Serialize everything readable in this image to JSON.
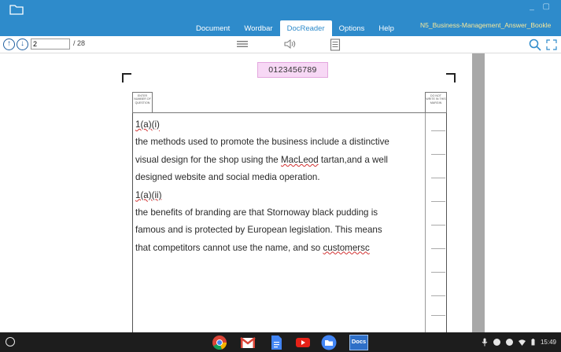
{
  "window": {
    "document_title": "N5_Business-Management_Answer_Bookle",
    "controls_glyph": "_ ▢"
  },
  "menu": {
    "items": [
      {
        "label": "Document",
        "active": false
      },
      {
        "label": "Wordbar",
        "active": false
      },
      {
        "label": "DocReader",
        "active": true
      },
      {
        "label": "Options",
        "active": false
      },
      {
        "label": "Help",
        "active": false
      }
    ]
  },
  "toolbar": {
    "page_input_value": "2",
    "page_count": "/ 28",
    "up_glyph": "↑",
    "down_glyph": "↓"
  },
  "sheet": {
    "candidate_number": "0123456789",
    "left_header_text": "ENTER NUMBER OF QUESTION",
    "right_header_text": "DO NOT WRITE IN THIS MARGIN"
  },
  "answer": {
    "lines": [
      "1(a)(i)",
      "the methods used to promote the business include a distinctive",
      "visual design for the shop using the MacLeod tartan,and a well",
      "designed website and social media operation.",
      "1(a)(ii)",
      "the benefits of branding are that Stornoway black pudding is",
      "famous and is protected by European legislation. This means",
      "that competitors cannot use the name, and so customersc"
    ],
    "line1_label": "1(a)(i)",
    "line2": "the methods used to promote the business include a distinctive",
    "line3_pre": "visual design for the shop using the ",
    "line3_misspelled": "MacLeod",
    "line3_post": " tartan,and a well",
    "line4": "designed website and social media operation.",
    "line5_label": "1(a)(ii)",
    "line6": "the benefits of branding are that Stornoway black pudding is",
    "line7": "famous and is protected by European legislation. This means",
    "line8_pre": "that competitors cannot use the name, and so ",
    "line8_misspelled": "customersc"
  },
  "shelf": {
    "apps": [
      "chrome-icon",
      "gmail-icon",
      "google-docs-icon",
      "youtube-icon",
      "files-icon",
      "docs-app-icon"
    ],
    "docs_app_label": "Docs",
    "time": "15:49"
  },
  "colors": {
    "accent": "#2e8bcb",
    "title_text": "#f5e79a",
    "candidate_box": "#f7d8f5",
    "spellcheck": "#d23030"
  }
}
